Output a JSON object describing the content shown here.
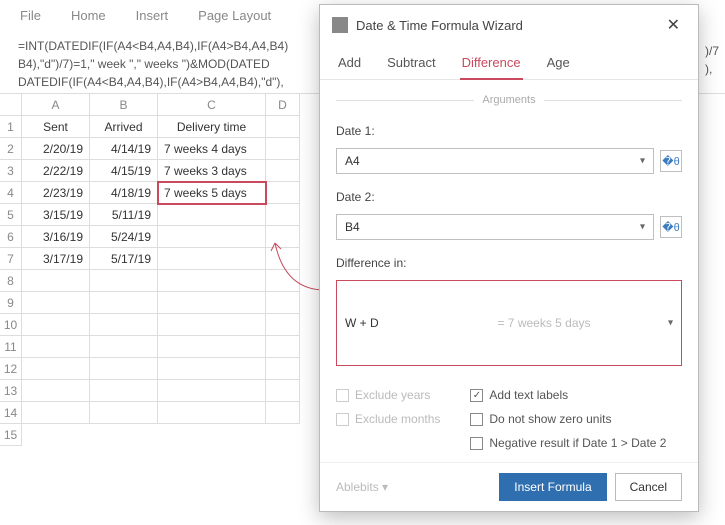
{
  "ribbon": {
    "file": "File",
    "home": "Home",
    "insert": "Insert",
    "page_layout": "Page Layout"
  },
  "formula_bar": {
    "line1": "=INT(DATEDIF(IF(A4<B4,A4,B4),IF(A4>B4,A4,B4)",
    "line2": "B4),\"d\")/7)=1,\" week \",\" weeks \")&MOD(DATED",
    "line3": "DATEDIF(IF(A4<B4,A4,B4),IF(A4>B4,A4,B4),\"d\"),",
    "tail1": ")/7",
    "tail2": "),"
  },
  "cols": {
    "A": "A",
    "B": "B",
    "C": "C",
    "D": "D"
  },
  "rows": [
    "1",
    "2",
    "3",
    "4",
    "5",
    "6",
    "7",
    "8",
    "9",
    "10",
    "11",
    "12",
    "13",
    "14",
    "15"
  ],
  "table": {
    "headers": {
      "A": "Sent",
      "B": "Arrived",
      "C": "Delivery time"
    },
    "data": [
      {
        "A": "2/20/19",
        "B": "4/14/19",
        "C": "7 weeks 4 days"
      },
      {
        "A": "2/22/19",
        "B": "4/15/19",
        "C": "7 weeks 3 days"
      },
      {
        "A": "2/23/19",
        "B": "4/18/19",
        "C": "7 weeks 5 days"
      },
      {
        "A": "3/15/19",
        "B": "5/11/19",
        "C": ""
      },
      {
        "A": "3/16/19",
        "B": "5/24/19",
        "C": ""
      },
      {
        "A": "3/17/19",
        "B": "5/17/19",
        "C": ""
      }
    ]
  },
  "dialog": {
    "title": "Date & Time Formula Wizard",
    "tabs": {
      "add": "Add",
      "subtract": "Subtract",
      "difference": "Difference",
      "age": "Age"
    },
    "section_arguments": "Arguments",
    "date1_label": "Date 1:",
    "date1_value": "A4",
    "date2_label": "Date 2:",
    "date2_value": "B4",
    "diff_label": "Difference in:",
    "diff_value": "W + D",
    "diff_preview": "= 7 weeks 5 days",
    "chk_excl_years": "Exclude years",
    "chk_excl_months": "Exclude months",
    "chk_add_labels": "Add text labels",
    "chk_no_zero": "Do not show zero units",
    "chk_negative": "Negative result if Date 1 > Date 2",
    "brand": "Ablebits",
    "insert_btn": "Insert Formula",
    "cancel_btn": "Cancel"
  }
}
